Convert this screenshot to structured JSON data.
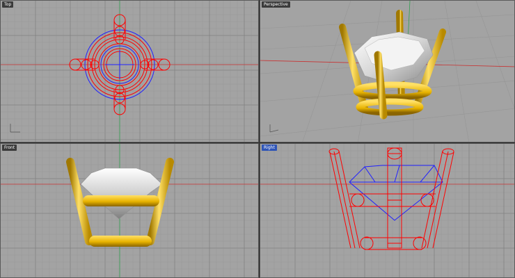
{
  "viewports": [
    {
      "id": "top",
      "label": "Top",
      "active": false
    },
    {
      "id": "perspective",
      "label": "Perspective",
      "active": false
    },
    {
      "id": "front",
      "label": "Front",
      "active": false
    },
    {
      "id": "right",
      "label": "Right",
      "active": true
    }
  ],
  "colors": {
    "background": "#a3a3a3",
    "grid_minor": "#959595",
    "grid_major": "#7f7f7f",
    "axis_x": "#c83232",
    "axis_y": "#32a050",
    "wire_prong": "#ff0000",
    "wire_stone": "#2020ff",
    "gold": "#e8b400",
    "gold_dark": "#a07800",
    "gold_light": "#ffe066",
    "stone": "#e9e9e9",
    "active_tab": "#2f55b7"
  },
  "icons": {
    "axis_widget": "axis-triad-icon"
  }
}
